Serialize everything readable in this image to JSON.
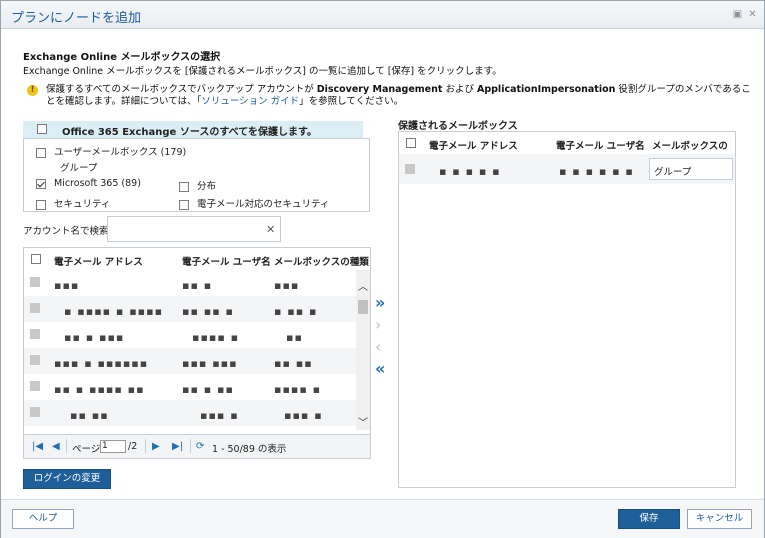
{
  "window": {
    "title": "プランにノードを追加",
    "icon_restore": "restore-icon",
    "icon_close": "close-icon"
  },
  "section": {
    "title": "Exchange Online メールボックスの選択",
    "description": "Exchange Online メールボックスを [保護されるメールボックス] の一覧に追加して [保存] をクリックします。",
    "warning_icon": "warning-icon",
    "warning_prefix": "保護するすべてのメールボックスでバックアップ アカウントが ",
    "warning_bold1": "Discovery Management",
    "warning_mid": " および ",
    "warning_bold2": "ApplicationImpersonation",
    "warning_suffix": " 役割グループのメンバであることを確認します。詳細については、「",
    "warning_link": "ソリューション ガイド",
    "warning_end": "」を参照してください。"
  },
  "source": {
    "protect_all_label": "Office 365 Exchange ソースのすべてを保護します。",
    "user_mailboxes_label": "ユーザーメールボックス (179)",
    "groups_label": "グループ",
    "microsoft365_label": "Microsoft 365 (89)",
    "distribution_label": "分布",
    "security_label": "セキュリティ",
    "mail_security_label": "電子メール対応のセキュリティ"
  },
  "search": {
    "label": "アカウント名で検索",
    "value": "",
    "clear_icon": "clear-icon"
  },
  "left_grid": {
    "columns": [
      "電子メール アドレス",
      "電子メール ユーザ名",
      "メールボックスの種類"
    ],
    "rows": [
      {
        "email": "▪▪▪",
        "user": "▪▪  ▪",
        "type": "▪▪▪"
      },
      {
        "email": "▪  ▪▪▪▪  ▪  ▪▪▪▪",
        "user": "▪▪  ▪▪  ▪",
        "type": "▪  ▪▪  ▪"
      },
      {
        "email": "▪▪  ▪  ▪▪▪",
        "user": "▪▪▪▪  ▪",
        "type": "▪▪"
      },
      {
        "email": "▪▪▪  ▪  ▪▪▪▪▪▪",
        "user": "▪▪▪  ▪▪▪",
        "type": "▪▪  ▪▪"
      },
      {
        "email": "▪▪  ▪  ▪▪▪▪  ▪▪",
        "user": "▪▪  ▪  ▪▪",
        "type": "▪▪▪▪  ▪"
      },
      {
        "email": "▪▪    ▪▪",
        "user": "▪▪▪  ▪",
        "type": "▪▪▪  ▪"
      }
    ]
  },
  "pager": {
    "page_label": "ページ",
    "page_value": "1",
    "page_total": "/2",
    "range_text": "1 - 50/89 の表示"
  },
  "change_login_label": "ログインの変更",
  "right_grid": {
    "title": "保護されるメールボックス",
    "columns": [
      "電子メール アドレス",
      "電子メール ユーザ名",
      "メールボックスの種類"
    ],
    "rows": [
      {
        "email": "▪ ▪ ▪ ▪ ▪",
        "user": "▪ ▪ ▪ ▪ ▪ ▪",
        "type": "グループ"
      }
    ]
  },
  "footer": {
    "help_label": "ヘルプ",
    "save_label": "保存",
    "cancel_label": "キャンセル"
  },
  "colors": {
    "accent": "#1e5f99",
    "header_band": "#dbeef6",
    "link": "#1a5c9e"
  }
}
